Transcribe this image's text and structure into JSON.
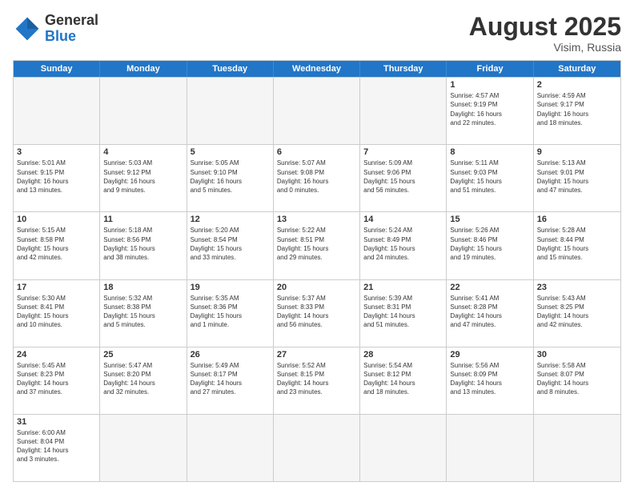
{
  "header": {
    "logo_general": "General",
    "logo_blue": "Blue",
    "month_title": "August 2025",
    "location": "Visim, Russia"
  },
  "weekdays": [
    "Sunday",
    "Monday",
    "Tuesday",
    "Wednesday",
    "Thursday",
    "Friday",
    "Saturday"
  ],
  "rows": [
    [
      {
        "day": "",
        "info": ""
      },
      {
        "day": "",
        "info": ""
      },
      {
        "day": "",
        "info": ""
      },
      {
        "day": "",
        "info": ""
      },
      {
        "day": "",
        "info": ""
      },
      {
        "day": "1",
        "info": "Sunrise: 4:57 AM\nSunset: 9:19 PM\nDaylight: 16 hours\nand 22 minutes."
      },
      {
        "day": "2",
        "info": "Sunrise: 4:59 AM\nSunset: 9:17 PM\nDaylight: 16 hours\nand 18 minutes."
      }
    ],
    [
      {
        "day": "3",
        "info": "Sunrise: 5:01 AM\nSunset: 9:15 PM\nDaylight: 16 hours\nand 13 minutes."
      },
      {
        "day": "4",
        "info": "Sunrise: 5:03 AM\nSunset: 9:12 PM\nDaylight: 16 hours\nand 9 minutes."
      },
      {
        "day": "5",
        "info": "Sunrise: 5:05 AM\nSunset: 9:10 PM\nDaylight: 16 hours\nand 5 minutes."
      },
      {
        "day": "6",
        "info": "Sunrise: 5:07 AM\nSunset: 9:08 PM\nDaylight: 16 hours\nand 0 minutes."
      },
      {
        "day": "7",
        "info": "Sunrise: 5:09 AM\nSunset: 9:06 PM\nDaylight: 15 hours\nand 56 minutes."
      },
      {
        "day": "8",
        "info": "Sunrise: 5:11 AM\nSunset: 9:03 PM\nDaylight: 15 hours\nand 51 minutes."
      },
      {
        "day": "9",
        "info": "Sunrise: 5:13 AM\nSunset: 9:01 PM\nDaylight: 15 hours\nand 47 minutes."
      }
    ],
    [
      {
        "day": "10",
        "info": "Sunrise: 5:15 AM\nSunset: 8:58 PM\nDaylight: 15 hours\nand 42 minutes."
      },
      {
        "day": "11",
        "info": "Sunrise: 5:18 AM\nSunset: 8:56 PM\nDaylight: 15 hours\nand 38 minutes."
      },
      {
        "day": "12",
        "info": "Sunrise: 5:20 AM\nSunset: 8:54 PM\nDaylight: 15 hours\nand 33 minutes."
      },
      {
        "day": "13",
        "info": "Sunrise: 5:22 AM\nSunset: 8:51 PM\nDaylight: 15 hours\nand 29 minutes."
      },
      {
        "day": "14",
        "info": "Sunrise: 5:24 AM\nSunset: 8:49 PM\nDaylight: 15 hours\nand 24 minutes."
      },
      {
        "day": "15",
        "info": "Sunrise: 5:26 AM\nSunset: 8:46 PM\nDaylight: 15 hours\nand 19 minutes."
      },
      {
        "day": "16",
        "info": "Sunrise: 5:28 AM\nSunset: 8:44 PM\nDaylight: 15 hours\nand 15 minutes."
      }
    ],
    [
      {
        "day": "17",
        "info": "Sunrise: 5:30 AM\nSunset: 8:41 PM\nDaylight: 15 hours\nand 10 minutes."
      },
      {
        "day": "18",
        "info": "Sunrise: 5:32 AM\nSunset: 8:38 PM\nDaylight: 15 hours\nand 5 minutes."
      },
      {
        "day": "19",
        "info": "Sunrise: 5:35 AM\nSunset: 8:36 PM\nDaylight: 15 hours\nand 1 minute."
      },
      {
        "day": "20",
        "info": "Sunrise: 5:37 AM\nSunset: 8:33 PM\nDaylight: 14 hours\nand 56 minutes."
      },
      {
        "day": "21",
        "info": "Sunrise: 5:39 AM\nSunset: 8:31 PM\nDaylight: 14 hours\nand 51 minutes."
      },
      {
        "day": "22",
        "info": "Sunrise: 5:41 AM\nSunset: 8:28 PM\nDaylight: 14 hours\nand 47 minutes."
      },
      {
        "day": "23",
        "info": "Sunrise: 5:43 AM\nSunset: 8:25 PM\nDaylight: 14 hours\nand 42 minutes."
      }
    ],
    [
      {
        "day": "24",
        "info": "Sunrise: 5:45 AM\nSunset: 8:23 PM\nDaylight: 14 hours\nand 37 minutes."
      },
      {
        "day": "25",
        "info": "Sunrise: 5:47 AM\nSunset: 8:20 PM\nDaylight: 14 hours\nand 32 minutes."
      },
      {
        "day": "26",
        "info": "Sunrise: 5:49 AM\nSunset: 8:17 PM\nDaylight: 14 hours\nand 27 minutes."
      },
      {
        "day": "27",
        "info": "Sunrise: 5:52 AM\nSunset: 8:15 PM\nDaylight: 14 hours\nand 23 minutes."
      },
      {
        "day": "28",
        "info": "Sunrise: 5:54 AM\nSunset: 8:12 PM\nDaylight: 14 hours\nand 18 minutes."
      },
      {
        "day": "29",
        "info": "Sunrise: 5:56 AM\nSunset: 8:09 PM\nDaylight: 14 hours\nand 13 minutes."
      },
      {
        "day": "30",
        "info": "Sunrise: 5:58 AM\nSunset: 8:07 PM\nDaylight: 14 hours\nand 8 minutes."
      }
    ],
    [
      {
        "day": "31",
        "info": "Sunrise: 6:00 AM\nSunset: 8:04 PM\nDaylight: 14 hours\nand 3 minutes."
      },
      {
        "day": "",
        "info": ""
      },
      {
        "day": "",
        "info": ""
      },
      {
        "day": "",
        "info": ""
      },
      {
        "day": "",
        "info": ""
      },
      {
        "day": "",
        "info": ""
      },
      {
        "day": "",
        "info": ""
      }
    ]
  ]
}
